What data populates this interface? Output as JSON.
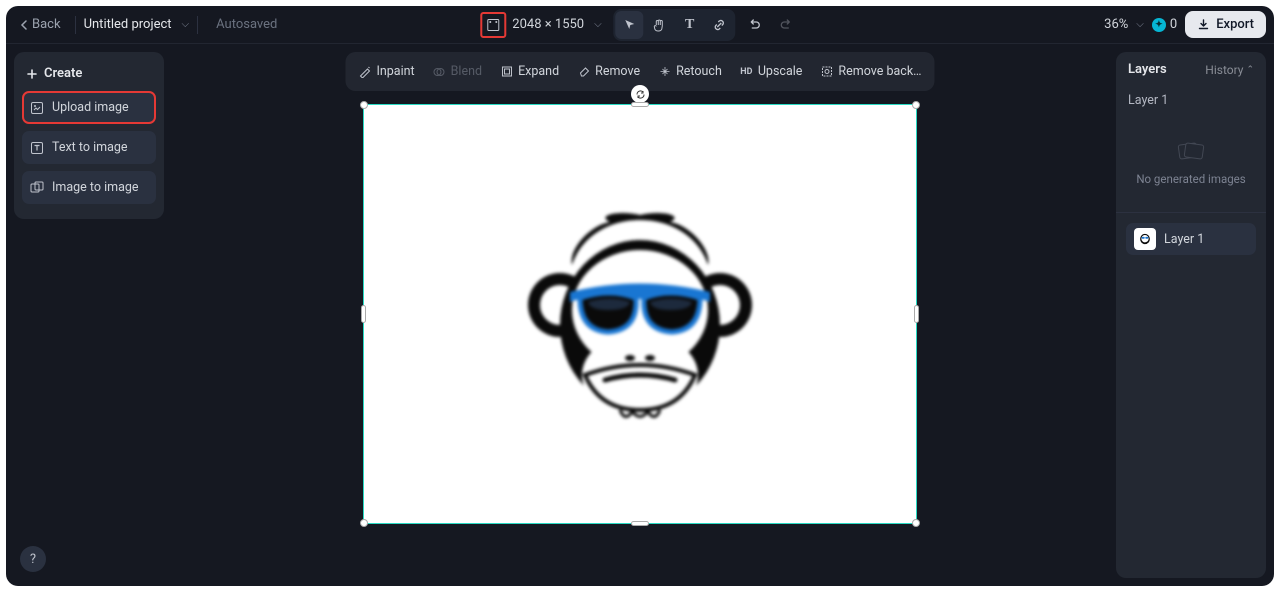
{
  "header": {
    "back": "Back",
    "project_name": "Untitled project",
    "autosaved": "Autosaved",
    "dimensions": "2048 × 1550",
    "zoom": "36%",
    "credits": "0",
    "export": "Export"
  },
  "left_panel": {
    "title": "Create",
    "buttons": {
      "upload": "Upload image",
      "text_to_image": "Text to image",
      "image_to_image": "Image to image"
    }
  },
  "toolbar": {
    "inpaint": "Inpaint",
    "blend": "Blend",
    "expand": "Expand",
    "remove": "Remove",
    "retouch": "Retouch",
    "upscale": "Upscale",
    "remove_bg": "Remove back…"
  },
  "right_panel": {
    "layers_tab": "Layers",
    "history_tab": "History",
    "selected_layer": "Layer 1",
    "empty_text": "No generated images",
    "layer_item": "Layer 1"
  }
}
